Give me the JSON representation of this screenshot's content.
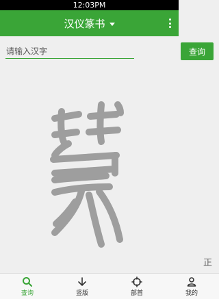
{
  "status_bar": {
    "time": "12:03PM"
  },
  "app_bar": {
    "title": "汉仪篆书",
    "menu_icon": "more-vertical-icon",
    "dropdown_icon": "caret-down-icon"
  },
  "search": {
    "placeholder": "请输入汉字",
    "value": "",
    "button_label": "查询"
  },
  "preview": {
    "glyph_description_icon": "seal-script-glyph",
    "toggle_label": "正"
  },
  "bottom_nav": {
    "items": [
      {
        "label": "查询",
        "icon": "search-icon",
        "active": true
      },
      {
        "label": "竖版",
        "icon": "arrow-down-icon",
        "active": false
      },
      {
        "label": "部首",
        "icon": "crosshair-icon",
        "active": false
      },
      {
        "label": "我的",
        "icon": "user-icon",
        "active": false
      }
    ]
  },
  "colors": {
    "accent": "#3aa537",
    "glyph": "#9e9e9e"
  }
}
